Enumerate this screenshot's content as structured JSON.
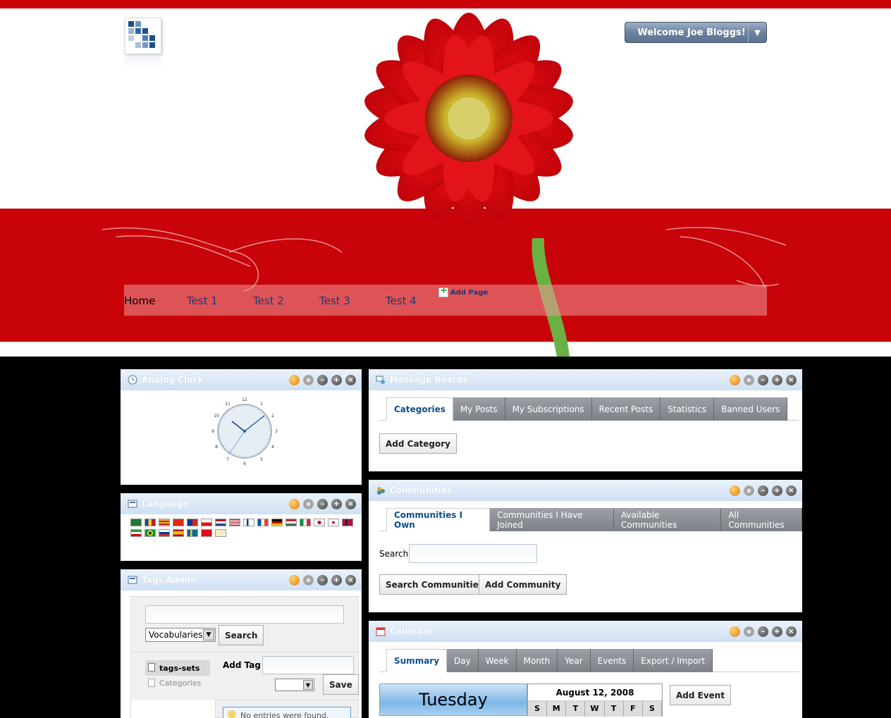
{
  "header": {
    "welcome_label": "Welcome Joe Bloggs!",
    "dropdown_arrow": "▼",
    "nav": [
      "Home",
      "Test 1",
      "Test 2",
      "Test 3",
      "Test 4"
    ],
    "add_page": "Add Page",
    "colors": {
      "brand_red": "#c8030a",
      "nav_text": "#153a7a"
    }
  },
  "portlets": {
    "clock": {
      "title": "Analog Clock",
      "icon": "clock-icon"
    },
    "language": {
      "title": "Language",
      "icon": "language-icon",
      "flags": [
        "saudi-arabia",
        "catalonia",
        "catalonia",
        "china",
        "taiwan",
        "czech-republic",
        "netherlands",
        "usa",
        "finland",
        "france",
        "germany",
        "hungary",
        "italy",
        "japan",
        "korea",
        "norway",
        "iran",
        "brazil",
        "russia",
        "spain",
        "sweden",
        "turkey",
        "vietnam"
      ]
    },
    "tags_admin": {
      "title": "Tags Admin",
      "icon": "tags-icon",
      "vocab_select": "Vocabularies",
      "search_button": "Search",
      "tree": [
        "tags-sets",
        "Categories"
      ],
      "add_tag_label": "Add Tag",
      "save_button": "Save",
      "no_entries": "No entries were found."
    },
    "message_boards": {
      "title": "Message Boards",
      "icon": "message-boards-icon",
      "tabs": [
        "Categories",
        "My Posts",
        "My Subscriptions",
        "Recent Posts",
        "Statistics",
        "Banned Users"
      ],
      "add_category": "Add Category"
    },
    "communities": {
      "title": "Communities",
      "icon": "communities-icon",
      "tabs": [
        "Communities I Own",
        "Communities I Have Joined",
        "Available Communities",
        "All Communities"
      ],
      "search_label": "Search",
      "search_button": "Search Communities",
      "add_button": "Add Community"
    },
    "calendar": {
      "title": "Calendar",
      "icon": "calendar-icon",
      "tabs": [
        "Summary",
        "Day",
        "Week",
        "Month",
        "Year",
        "Events",
        "Export / Import"
      ],
      "day_name": "Tuesday",
      "month_title": "August 12, 2008",
      "weekdays": [
        "S",
        "M",
        "T",
        "W",
        "T",
        "F",
        "S"
      ],
      "add_event": "Add Event"
    }
  }
}
